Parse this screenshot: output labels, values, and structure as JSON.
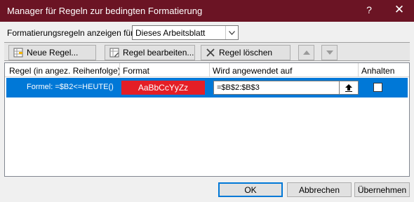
{
  "window": {
    "title": "Manager für Regeln zur bedingten Formatierung",
    "help_glyph": "?",
    "close_glyph": "✕"
  },
  "show_rules": {
    "label": "Formatierungsregeln anzeigen für:",
    "selected": "Dieses Arbeitsblatt"
  },
  "toolbar": {
    "new_rule": "Neue Regel...",
    "edit_rule": "Regel bearbeiten...",
    "delete_rule": "Regel löschen"
  },
  "grid": {
    "columns": [
      "Regel (in angez. Reihenfolge)",
      "Format",
      "Wird angewendet auf",
      "Anhalten"
    ],
    "rows": [
      {
        "rule": "Formel: =$B2<=HEUTE()",
        "format_preview": "AaBbCcYyZz",
        "applies_to": "=$B$2:$B$3",
        "stop_if_true": false
      }
    ]
  },
  "buttons": {
    "ok": "OK",
    "cancel": "Abbrechen",
    "apply": "Übernehmen"
  },
  "colors": {
    "titlebar": "#6b1424",
    "selection": "#0078d7",
    "format_fill": "#e41e26"
  }
}
